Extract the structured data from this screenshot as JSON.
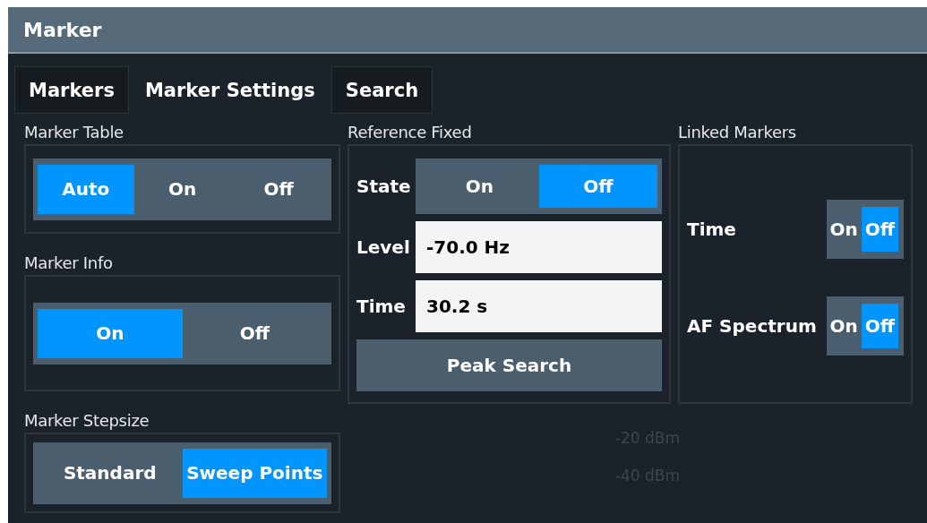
{
  "window": {
    "title": "Marker"
  },
  "tabs": [
    {
      "label": "Markers",
      "selected": false
    },
    {
      "label": "Marker Settings",
      "selected": true
    },
    {
      "label": "Search",
      "selected": false
    }
  ],
  "marker_table": {
    "label": "Marker Table",
    "options": [
      {
        "label": "Auto",
        "selected": true
      },
      {
        "label": "On",
        "selected": false
      },
      {
        "label": "Off",
        "selected": false
      }
    ]
  },
  "marker_info": {
    "label": "Marker Info",
    "options": [
      {
        "label": "On",
        "selected": true
      },
      {
        "label": "Off",
        "selected": false
      }
    ]
  },
  "marker_stepsize": {
    "label": "Marker Stepsize",
    "options": [
      {
        "label": "Standard",
        "selected": false
      },
      {
        "label": "Sweep Points",
        "selected": true
      }
    ]
  },
  "reference_fixed": {
    "label": "Reference Fixed",
    "state": {
      "label": "State",
      "options": [
        {
          "label": "On",
          "selected": false
        },
        {
          "label": "Off",
          "selected": true
        }
      ]
    },
    "level": {
      "label": "Level",
      "value": "-70.0 Hz"
    },
    "time": {
      "label": "Time",
      "value": "30.2 s"
    },
    "peak_search": "Peak Search"
  },
  "linked_markers": {
    "label": "Linked Markers",
    "items": [
      {
        "label": "Time",
        "options": [
          {
            "label": "On",
            "selected": false
          },
          {
            "label": "Off",
            "selected": true
          }
        ]
      },
      {
        "label": "AF Spectrum",
        "options": [
          {
            "label": "On",
            "selected": false
          },
          {
            "label": "Off",
            "selected": true
          }
        ]
      }
    ]
  },
  "background_labels": [
    "-20 dBm",
    "-40 dBm"
  ]
}
